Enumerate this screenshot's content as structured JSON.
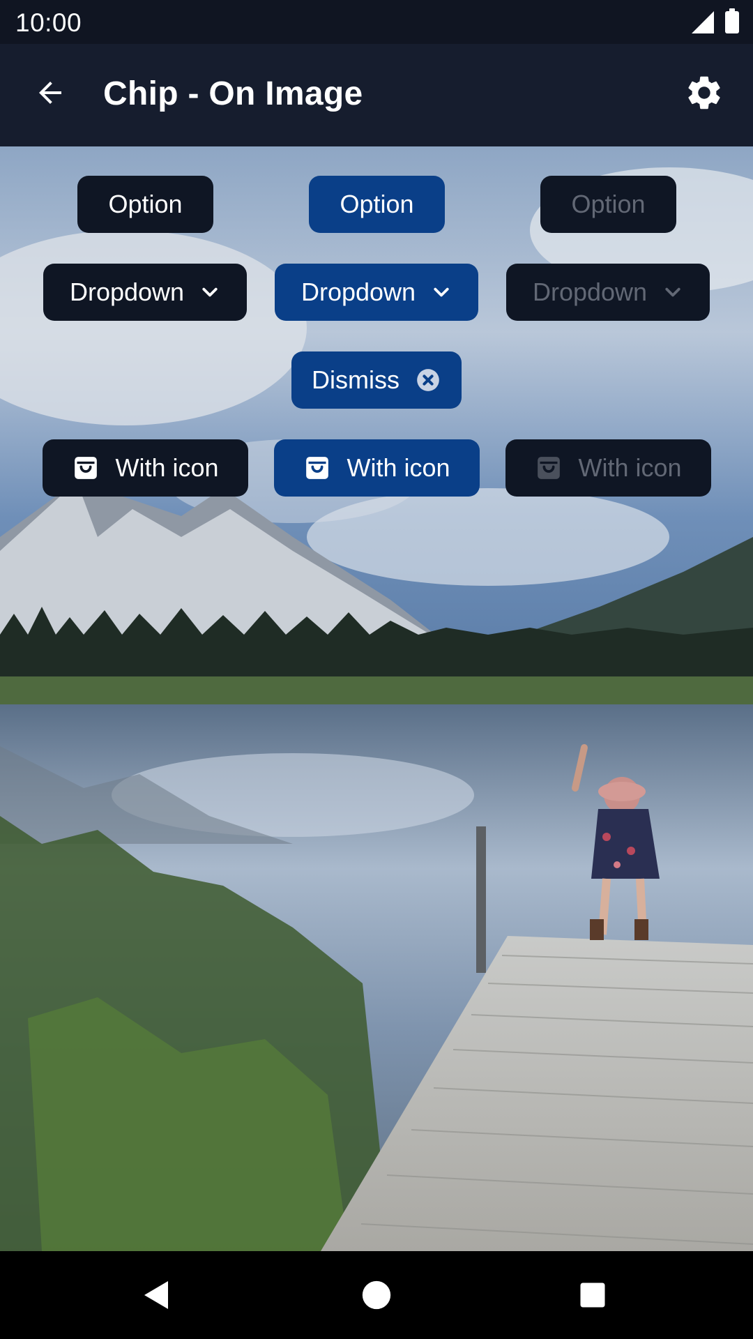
{
  "status_bar": {
    "time": "10:00",
    "signal_icon": "cell-signal-icon",
    "battery_icon": "battery-full-icon"
  },
  "app_bar": {
    "title": "Chip - On Image",
    "back_icon": "arrow-back-icon",
    "settings_icon": "gear-icon"
  },
  "chips": {
    "option": {
      "label": "Option",
      "states": [
        "default",
        "selected",
        "disabled"
      ]
    },
    "dropdown": {
      "label": "Dropdown",
      "icon": "chevron-down-icon",
      "states": [
        "default",
        "selected",
        "disabled"
      ]
    },
    "dismiss": {
      "label": "Dismiss",
      "icon": "close-circle-icon",
      "state": "selected"
    },
    "with_icon": {
      "label": "With icon",
      "icon": "shopping-bag-icon",
      "states": [
        "default",
        "selected",
        "disabled"
      ]
    }
  },
  "nav_bar": {
    "back_icon": "nav-back-triangle-icon",
    "home_icon": "nav-home-circle-icon",
    "recents_icon": "nav-recents-square-icon"
  },
  "colors": {
    "chip_default": "#0f1624",
    "chip_selected": "#0a3f88",
    "chip_disabled_text": "#626875",
    "app_bar": "#161d2e",
    "status_bar": "#101522"
  }
}
